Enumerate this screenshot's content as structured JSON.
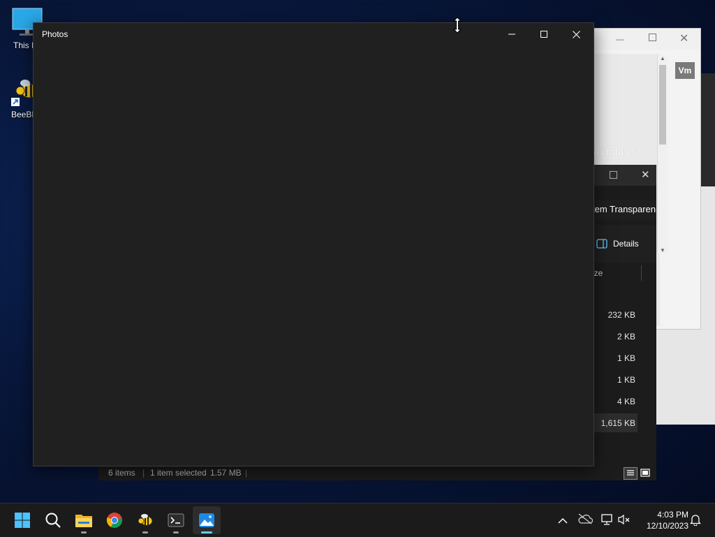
{
  "desktop": {
    "icons": [
      {
        "label": "This F",
        "icon": "monitor-icon"
      },
      {
        "label": "BeeBE",
        "icon": "bee-icon"
      }
    ]
  },
  "photos_window": {
    "title": "Photos",
    "minimize_icon": "minimize-icon",
    "maximize_icon": "maximize-icon",
    "close_icon": "close-icon"
  },
  "background_window": {
    "watermark": "Windows",
    "badge": "Vm"
  },
  "explorer_window": {
    "address_fragment": "tem Transparen",
    "details_label": "Details",
    "size_header": "Size",
    "sizes": [
      "232 KB",
      "2 KB",
      "1 KB",
      "1 KB",
      "4 KB",
      "1,615 KB"
    ],
    "status": {
      "items": "6 items",
      "selected": "1 item selected",
      "selected_size": "1.57 MB"
    }
  },
  "taskbar": {
    "apps": [
      "start-icon",
      "search-icon",
      "file-explorer-icon",
      "chrome-icon",
      "beebeep-icon",
      "terminal-icon",
      "photos-icon"
    ],
    "tray": [
      "chevron-up-icon",
      "onedrive-icon",
      "network-icon",
      "volume-muted-icon",
      "notification-icon"
    ],
    "time": "4:03 PM",
    "date": "12/10/2023"
  },
  "colors": {
    "accent": "#60cdff",
    "photos_bg": "#202020",
    "taskbar_bg": "#1b1b1b"
  }
}
